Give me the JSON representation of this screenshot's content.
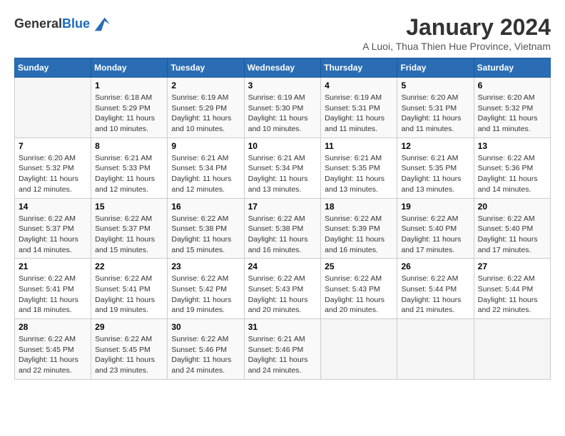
{
  "logo": {
    "general": "General",
    "blue": "Blue"
  },
  "header": {
    "title": "January 2024",
    "subtitle": "A Luoi, Thua Thien Hue Province, Vietnam"
  },
  "weekdays": [
    "Sunday",
    "Monday",
    "Tuesday",
    "Wednesday",
    "Thursday",
    "Friday",
    "Saturday"
  ],
  "weeks": [
    [
      {
        "day": "",
        "sunrise": "",
        "sunset": "",
        "daylight": ""
      },
      {
        "day": "1",
        "sunrise": "Sunrise: 6:18 AM",
        "sunset": "Sunset: 5:29 PM",
        "daylight": "Daylight: 11 hours and 10 minutes."
      },
      {
        "day": "2",
        "sunrise": "Sunrise: 6:19 AM",
        "sunset": "Sunset: 5:29 PM",
        "daylight": "Daylight: 11 hours and 10 minutes."
      },
      {
        "day": "3",
        "sunrise": "Sunrise: 6:19 AM",
        "sunset": "Sunset: 5:30 PM",
        "daylight": "Daylight: 11 hours and 10 minutes."
      },
      {
        "day": "4",
        "sunrise": "Sunrise: 6:19 AM",
        "sunset": "Sunset: 5:31 PM",
        "daylight": "Daylight: 11 hours and 11 minutes."
      },
      {
        "day": "5",
        "sunrise": "Sunrise: 6:20 AM",
        "sunset": "Sunset: 5:31 PM",
        "daylight": "Daylight: 11 hours and 11 minutes."
      },
      {
        "day": "6",
        "sunrise": "Sunrise: 6:20 AM",
        "sunset": "Sunset: 5:32 PM",
        "daylight": "Daylight: 11 hours and 11 minutes."
      }
    ],
    [
      {
        "day": "7",
        "sunrise": "Sunrise: 6:20 AM",
        "sunset": "Sunset: 5:32 PM",
        "daylight": "Daylight: 11 hours and 12 minutes."
      },
      {
        "day": "8",
        "sunrise": "Sunrise: 6:21 AM",
        "sunset": "Sunset: 5:33 PM",
        "daylight": "Daylight: 11 hours and 12 minutes."
      },
      {
        "day": "9",
        "sunrise": "Sunrise: 6:21 AM",
        "sunset": "Sunset: 5:34 PM",
        "daylight": "Daylight: 11 hours and 12 minutes."
      },
      {
        "day": "10",
        "sunrise": "Sunrise: 6:21 AM",
        "sunset": "Sunset: 5:34 PM",
        "daylight": "Daylight: 11 hours and 13 minutes."
      },
      {
        "day": "11",
        "sunrise": "Sunrise: 6:21 AM",
        "sunset": "Sunset: 5:35 PM",
        "daylight": "Daylight: 11 hours and 13 minutes."
      },
      {
        "day": "12",
        "sunrise": "Sunrise: 6:21 AM",
        "sunset": "Sunset: 5:35 PM",
        "daylight": "Daylight: 11 hours and 13 minutes."
      },
      {
        "day": "13",
        "sunrise": "Sunrise: 6:22 AM",
        "sunset": "Sunset: 5:36 PM",
        "daylight": "Daylight: 11 hours and 14 minutes."
      }
    ],
    [
      {
        "day": "14",
        "sunrise": "Sunrise: 6:22 AM",
        "sunset": "Sunset: 5:37 PM",
        "daylight": "Daylight: 11 hours and 14 minutes."
      },
      {
        "day": "15",
        "sunrise": "Sunrise: 6:22 AM",
        "sunset": "Sunset: 5:37 PM",
        "daylight": "Daylight: 11 hours and 15 minutes."
      },
      {
        "day": "16",
        "sunrise": "Sunrise: 6:22 AM",
        "sunset": "Sunset: 5:38 PM",
        "daylight": "Daylight: 11 hours and 15 minutes."
      },
      {
        "day": "17",
        "sunrise": "Sunrise: 6:22 AM",
        "sunset": "Sunset: 5:38 PM",
        "daylight": "Daylight: 11 hours and 16 minutes."
      },
      {
        "day": "18",
        "sunrise": "Sunrise: 6:22 AM",
        "sunset": "Sunset: 5:39 PM",
        "daylight": "Daylight: 11 hours and 16 minutes."
      },
      {
        "day": "19",
        "sunrise": "Sunrise: 6:22 AM",
        "sunset": "Sunset: 5:40 PM",
        "daylight": "Daylight: 11 hours and 17 minutes."
      },
      {
        "day": "20",
        "sunrise": "Sunrise: 6:22 AM",
        "sunset": "Sunset: 5:40 PM",
        "daylight": "Daylight: 11 hours and 17 minutes."
      }
    ],
    [
      {
        "day": "21",
        "sunrise": "Sunrise: 6:22 AM",
        "sunset": "Sunset: 5:41 PM",
        "daylight": "Daylight: 11 hours and 18 minutes."
      },
      {
        "day": "22",
        "sunrise": "Sunrise: 6:22 AM",
        "sunset": "Sunset: 5:41 PM",
        "daylight": "Daylight: 11 hours and 19 minutes."
      },
      {
        "day": "23",
        "sunrise": "Sunrise: 6:22 AM",
        "sunset": "Sunset: 5:42 PM",
        "daylight": "Daylight: 11 hours and 19 minutes."
      },
      {
        "day": "24",
        "sunrise": "Sunrise: 6:22 AM",
        "sunset": "Sunset: 5:43 PM",
        "daylight": "Daylight: 11 hours and 20 minutes."
      },
      {
        "day": "25",
        "sunrise": "Sunrise: 6:22 AM",
        "sunset": "Sunset: 5:43 PM",
        "daylight": "Daylight: 11 hours and 20 minutes."
      },
      {
        "day": "26",
        "sunrise": "Sunrise: 6:22 AM",
        "sunset": "Sunset: 5:44 PM",
        "daylight": "Daylight: 11 hours and 21 minutes."
      },
      {
        "day": "27",
        "sunrise": "Sunrise: 6:22 AM",
        "sunset": "Sunset: 5:44 PM",
        "daylight": "Daylight: 11 hours and 22 minutes."
      }
    ],
    [
      {
        "day": "28",
        "sunrise": "Sunrise: 6:22 AM",
        "sunset": "Sunset: 5:45 PM",
        "daylight": "Daylight: 11 hours and 22 minutes."
      },
      {
        "day": "29",
        "sunrise": "Sunrise: 6:22 AM",
        "sunset": "Sunset: 5:45 PM",
        "daylight": "Daylight: 11 hours and 23 minutes."
      },
      {
        "day": "30",
        "sunrise": "Sunrise: 6:22 AM",
        "sunset": "Sunset: 5:46 PM",
        "daylight": "Daylight: 11 hours and 24 minutes."
      },
      {
        "day": "31",
        "sunrise": "Sunrise: 6:21 AM",
        "sunset": "Sunset: 5:46 PM",
        "daylight": "Daylight: 11 hours and 24 minutes."
      },
      {
        "day": "",
        "sunrise": "",
        "sunset": "",
        "daylight": ""
      },
      {
        "day": "",
        "sunrise": "",
        "sunset": "",
        "daylight": ""
      },
      {
        "day": "",
        "sunrise": "",
        "sunset": "",
        "daylight": ""
      }
    ]
  ]
}
